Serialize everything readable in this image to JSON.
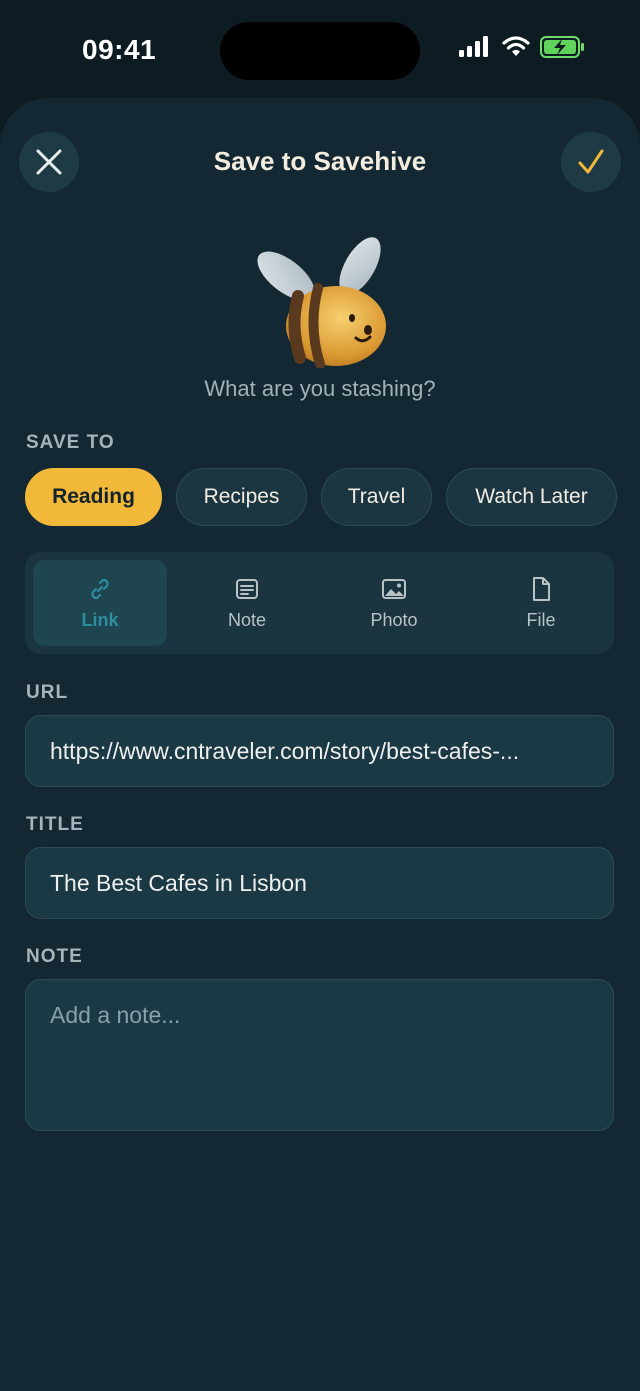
{
  "status_bar": {
    "time": "09:41"
  },
  "header": {
    "title": "Save to Savehive"
  },
  "prompt": "What are you stashing?",
  "save_to": {
    "label": "SAVE TO",
    "chips": [
      {
        "label": "Reading",
        "active": true
      },
      {
        "label": "Recipes",
        "active": false
      },
      {
        "label": "Travel",
        "active": false
      },
      {
        "label": "Watch Later",
        "active": false
      }
    ]
  },
  "types": [
    {
      "label": "Link",
      "icon": "link-icon",
      "active": true
    },
    {
      "label": "Note",
      "icon": "note-icon",
      "active": false
    },
    {
      "label": "Photo",
      "icon": "photo-icon",
      "active": false
    },
    {
      "label": "File",
      "icon": "file-icon",
      "active": false
    }
  ],
  "url": {
    "label": "URL",
    "value": "https://www.cntraveler.com/story/best-cafes-..."
  },
  "title_field": {
    "label": "TITLE",
    "value": "The Best Cafes in Lisbon"
  },
  "note": {
    "label": "NOTE",
    "placeholder": "Add a note..."
  },
  "colors": {
    "accent": "#f2b83a",
    "sheet": "#132833",
    "active_tab": "#2f8e9d"
  }
}
